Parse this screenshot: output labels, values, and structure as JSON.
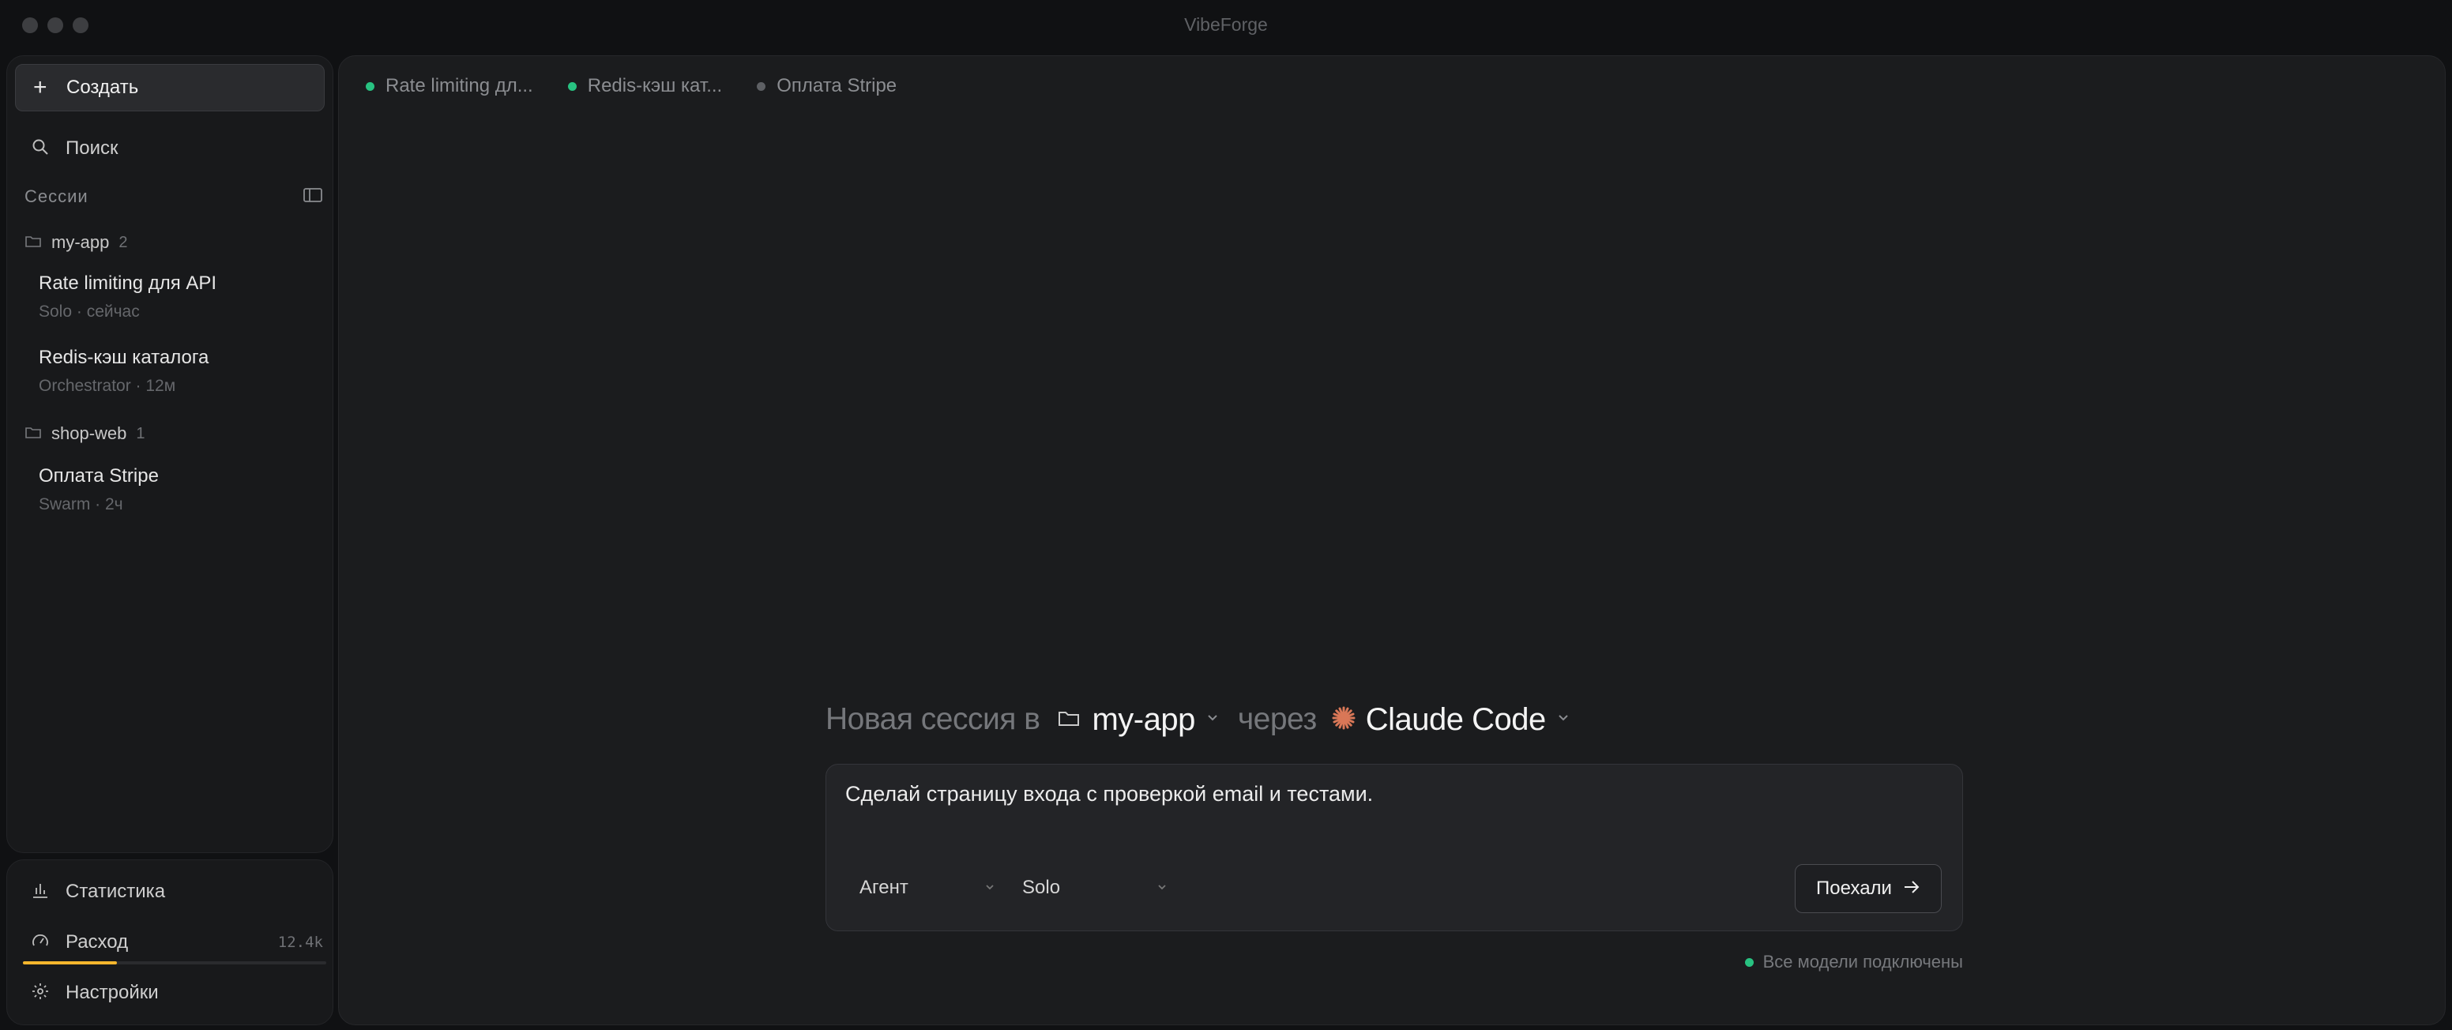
{
  "window": {
    "title": "VibeForge"
  },
  "sidebar": {
    "create_label": "Создать",
    "search_label": "Поиск",
    "sessions_label": "Сессии",
    "groups": [
      {
        "name": "my-app",
        "count": "2",
        "sessions": [
          {
            "title": "Rate limiting для API",
            "subtitle": "Solo · сейчас"
          },
          {
            "title": "Redis-кэш каталога",
            "subtitle": "Orchestrator · 12м"
          }
        ]
      },
      {
        "name": "shop-web",
        "count": "1",
        "sessions": [
          {
            "title": "Оплата Stripe",
            "subtitle": "Swarm · 2ч"
          }
        ]
      }
    ],
    "bottom": {
      "stats_label": "Статистика",
      "usage_label": "Расход",
      "usage_value": "12.4k",
      "usage_fraction": 0.31,
      "settings_label": "Настройки"
    }
  },
  "tabs": [
    {
      "label": "Rate limiting дл...",
      "status_color": "#28c281"
    },
    {
      "label": "Redis-кэш кат...",
      "status_color": "#28c281"
    },
    {
      "label": "Оплата Stripe",
      "status_color": "#5e6064"
    }
  ],
  "heading": {
    "prefix": "Новая сессия в",
    "project": "my-app",
    "via": "через",
    "agent_tool": "Claude Code"
  },
  "composer": {
    "value": "Сделай страницу входа с проверкой email и тестами.",
    "agent_select": "Агент",
    "mode_select": "Solo",
    "submit_label": "Поехали"
  },
  "status": {
    "text": "Все модели подключены",
    "color": "#28c281"
  },
  "colors": {
    "accent_green": "#28c281",
    "usage_bar": "#f5b62d",
    "claude_orange": "#d97757"
  }
}
